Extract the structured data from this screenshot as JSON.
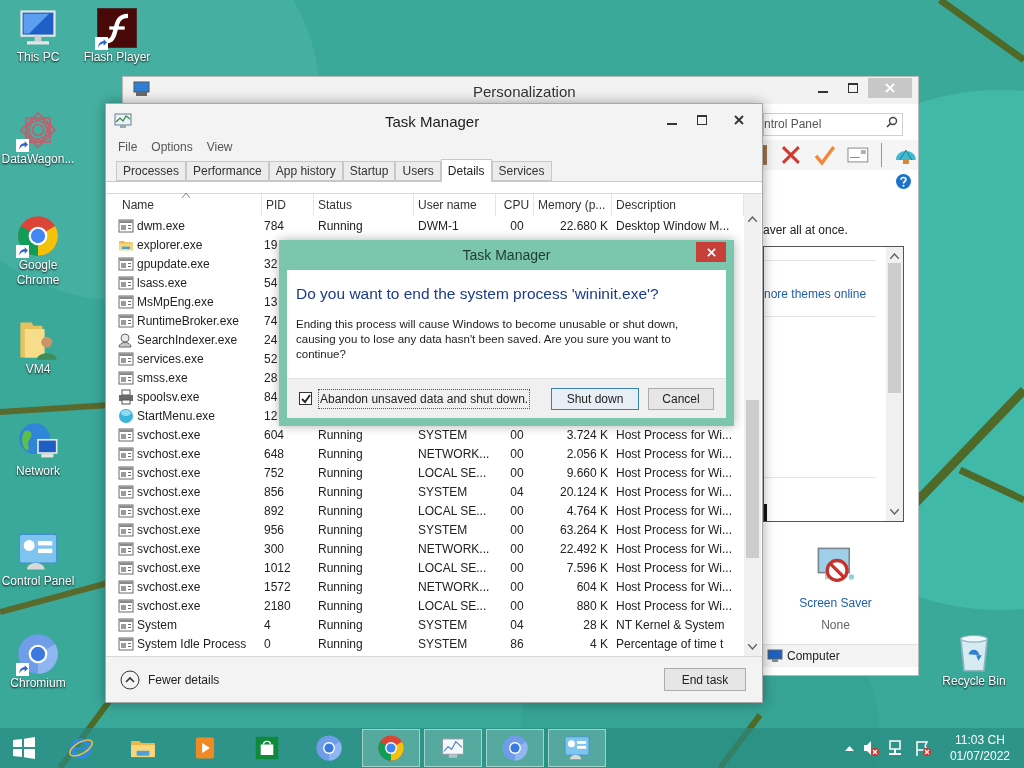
{
  "desktop_icons": [
    {
      "label": "This PC",
      "shortcut": false
    },
    {
      "label": "Flash Player",
      "shortcut": true
    },
    {
      "label": "DataWagon...",
      "shortcut": true
    },
    {
      "label": "Google Chrome",
      "shortcut": true
    },
    {
      "label": "VM4",
      "shortcut": false
    },
    {
      "label": "Network",
      "shortcut": false
    },
    {
      "label": "Control Panel",
      "shortcut": false
    },
    {
      "label": "Chromium",
      "shortcut": true
    },
    {
      "label": "Recycle Bin",
      "shortcut": false
    }
  ],
  "personalization": {
    "title": "Personalization",
    "search": {
      "placeholder": "ntrol Panel"
    },
    "intro": "aver all at once.",
    "link": "nore themes online",
    "screen_saver": {
      "label": "Screen Saver",
      "value": "None"
    },
    "status": "Computer"
  },
  "task_manager": {
    "title": "Task Manager",
    "menu": [
      "File",
      "Options",
      "View"
    ],
    "tabs": [
      {
        "label": "Processes",
        "selected": false
      },
      {
        "label": "Performance",
        "selected": false
      },
      {
        "label": "App history",
        "selected": false
      },
      {
        "label": "Startup",
        "selected": false
      },
      {
        "label": "Users",
        "selected": false
      },
      {
        "label": "Details",
        "selected": true
      },
      {
        "label": "Services",
        "selected": false
      }
    ],
    "columns": [
      "Name",
      "PID",
      "Status",
      "User name",
      "CPU",
      "Memory (p...",
      "Description"
    ],
    "rows": [
      {
        "kind": "app",
        "name": "dwm.exe",
        "pid": "784",
        "status": "Running",
        "user_name": "DWM-1",
        "cpu": "00",
        "memory": "22.680 K",
        "description": "Desktop Window M..."
      },
      {
        "kind": "folder",
        "name": "explorer.exe",
        "pid": "19"
      },
      {
        "kind": "app",
        "name": "gpupdate.exe",
        "pid": "32"
      },
      {
        "kind": "app",
        "name": "lsass.exe",
        "pid": "54"
      },
      {
        "kind": "app",
        "name": "MsMpEng.exe",
        "pid": "13"
      },
      {
        "kind": "app",
        "name": "RuntimeBroker.exe",
        "pid": "74"
      },
      {
        "kind": "search",
        "name": "SearchIndexer.exe",
        "pid": "24"
      },
      {
        "kind": "app",
        "name": "services.exe",
        "pid": "52"
      },
      {
        "kind": "app",
        "name": "smss.exe",
        "pid": "28"
      },
      {
        "kind": "printer",
        "name": "spoolsv.exe",
        "pid": "84"
      },
      {
        "kind": "globe",
        "name": "StartMenu.exe",
        "pid": "12"
      },
      {
        "kind": "app",
        "name": "svchost.exe",
        "pid": "604",
        "status": "Running",
        "user_name": "SYSTEM",
        "cpu": "00",
        "memory": "3.724 K",
        "description": "Host Process for Wi..."
      },
      {
        "kind": "app",
        "name": "svchost.exe",
        "pid": "648",
        "status": "Running",
        "user_name": "NETWORK...",
        "cpu": "00",
        "memory": "2.056 K",
        "description": "Host Process for Wi..."
      },
      {
        "kind": "app",
        "name": "svchost.exe",
        "pid": "752",
        "status": "Running",
        "user_name": "LOCAL SE...",
        "cpu": "00",
        "memory": "9.660 K",
        "description": "Host Process for Wi..."
      },
      {
        "kind": "app",
        "name": "svchost.exe",
        "pid": "856",
        "status": "Running",
        "user_name": "SYSTEM",
        "cpu": "04",
        "memory": "20.124 K",
        "description": "Host Process for Wi..."
      },
      {
        "kind": "app",
        "name": "svchost.exe",
        "pid": "892",
        "status": "Running",
        "user_name": "LOCAL SE...",
        "cpu": "00",
        "memory": "4.764 K",
        "description": "Host Process for Wi..."
      },
      {
        "kind": "app",
        "name": "svchost.exe",
        "pid": "956",
        "status": "Running",
        "user_name": "SYSTEM",
        "cpu": "00",
        "memory": "63.264 K",
        "description": "Host Process for Wi..."
      },
      {
        "kind": "app",
        "name": "svchost.exe",
        "pid": "300",
        "status": "Running",
        "user_name": "NETWORK...",
        "cpu": "00",
        "memory": "22.492 K",
        "description": "Host Process for Wi..."
      },
      {
        "kind": "app",
        "name": "svchost.exe",
        "pid": "1012",
        "status": "Running",
        "user_name": "LOCAL SE...",
        "cpu": "00",
        "memory": "7.596 K",
        "description": "Host Process for Wi..."
      },
      {
        "kind": "app",
        "name": "svchost.exe",
        "pid": "1572",
        "status": "Running",
        "user_name": "NETWORK...",
        "cpu": "00",
        "memory": "604 K",
        "description": "Host Process for Wi..."
      },
      {
        "kind": "app",
        "name": "svchost.exe",
        "pid": "2180",
        "status": "Running",
        "user_name": "LOCAL SE...",
        "cpu": "00",
        "memory": "880 K",
        "description": "Host Process for Wi..."
      },
      {
        "kind": "app",
        "name": "System",
        "pid": "4",
        "status": "Running",
        "user_name": "SYSTEM",
        "cpu": "04",
        "memory": "28 K",
        "description": "NT Kernel & System"
      },
      {
        "kind": "app",
        "name": "System Idle Process",
        "pid": "0",
        "status": "Running",
        "user_name": "SYSTEM",
        "cpu": "86",
        "memory": "4 K",
        "description": "Percentage of time t"
      }
    ],
    "fewer_details": "Fewer details",
    "end_task": "End task"
  },
  "dialog": {
    "title": "Task Manager",
    "question": "Do you want to end the system process 'wininit.exe'?",
    "message": "Ending this process will cause Windows to become unusable or shut down, causing you to lose any data hasn't been saved. Are you sure you want to continue?",
    "checkbox": {
      "label": "Abandon unsaved data and shut down.",
      "checked": true
    },
    "buttons": [
      {
        "label": "Shut down",
        "default": true
      },
      {
        "label": "Cancel",
        "default": false
      }
    ]
  },
  "taskbar": {
    "items": [
      {
        "running": false
      },
      {
        "running": false
      },
      {
        "running": false
      },
      {
        "running": false
      },
      {
        "running": false
      },
      {
        "running": false
      },
      {
        "running": true
      },
      {
        "running": true
      },
      {
        "running": true
      },
      {
        "running": true
      }
    ],
    "clock": {
      "time": "11:03 CH",
      "date": "01/07/2022"
    }
  }
}
